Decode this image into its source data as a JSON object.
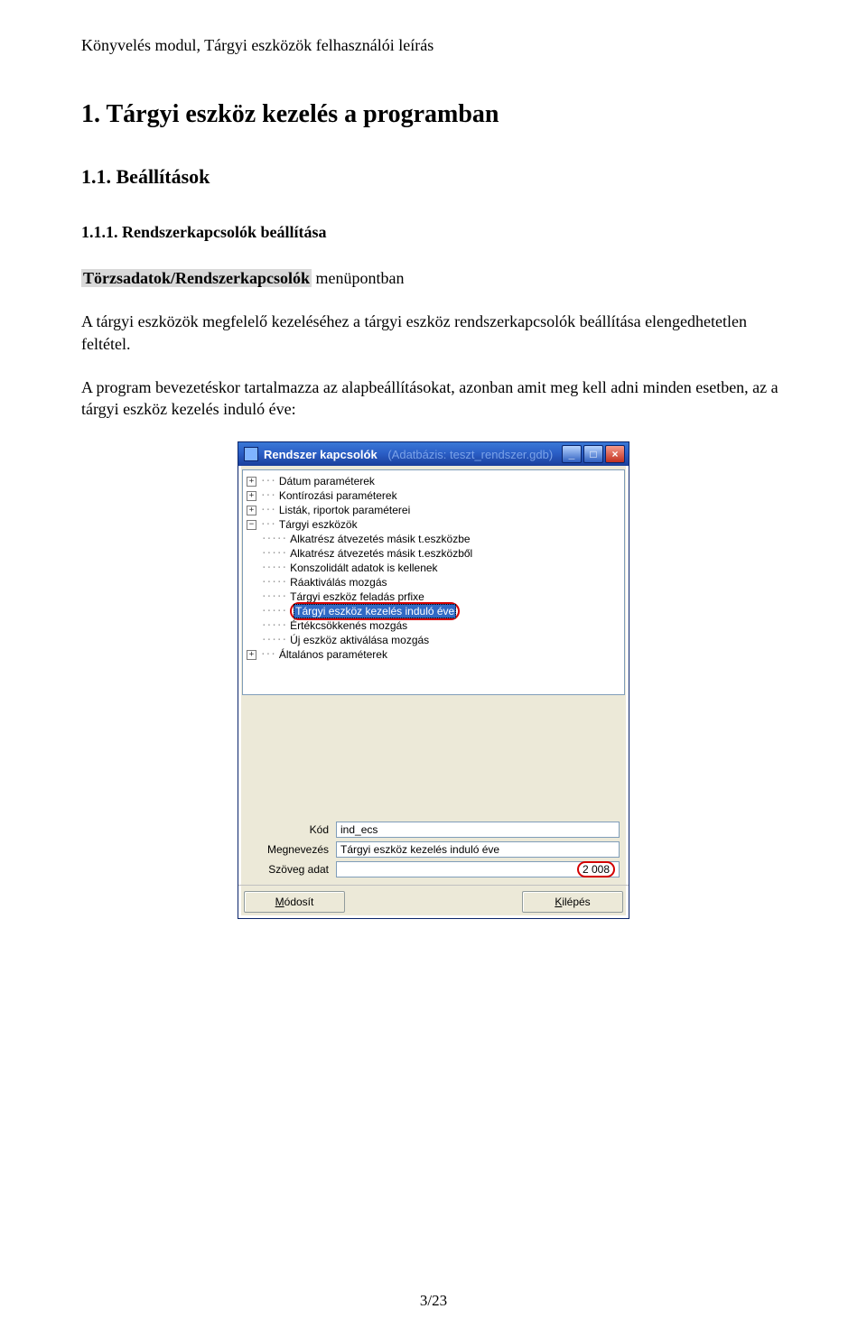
{
  "doc": {
    "header": "Könyvelés modul, Tárgyi eszközök felhasználói leírás",
    "h1": "1. Tárgyi eszköz kezelés a programban",
    "h2": "1.1. Beállítások",
    "h3": "1.1.1. Rendszerkapcsolók beállítása",
    "para1_pre": "",
    "menu_path": "Törzsadatok/Rendszerkapcsolók",
    "para1_post": " menüpontban",
    "para2": "A tárgyi eszközök megfelelő kezeléséhez a tárgyi eszköz rendszerkapcsolók beállítása elengedhetetlen feltétel.",
    "para3": "A program bevezetéskor tartalmazza az alapbeállításokat, azonban amit meg kell adni minden esetben, az a tárgyi eszköz kezelés induló éve:",
    "page_number": "3/23"
  },
  "window": {
    "title": "Rendszer kapcsolók",
    "title_faded": "(Adatbázis: teszt_rendszer.gdb)",
    "tree": {
      "top": [
        {
          "exp": "+",
          "label": "Dátum paraméterek"
        },
        {
          "exp": "+",
          "label": "Kontírozási paraméterek"
        },
        {
          "exp": "+",
          "label": "Listák, riportok paraméterei"
        },
        {
          "exp": "−",
          "label": "Tárgyi eszközök"
        }
      ],
      "children": [
        "Alkatrész átvezetés másik t.eszközbe",
        "Alkatrész átvezetés másik t.eszközből",
        "Konszolidált adatok is kellenek",
        "Ráaktiválás mozgás",
        "Tárgyi eszköz feladás prfixe"
      ],
      "selected": "Tárgyi eszköz kezelés induló éve",
      "children2": [
        "Értékcsökkenés mozgás",
        "Új eszköz aktiválása mozgás"
      ],
      "bottom": [
        {
          "exp": "+",
          "label": "Általános paraméterek"
        }
      ]
    },
    "form": {
      "kod_label": "Kód",
      "kod_value": "ind_ecs",
      "megnev_label": "Megnevezés",
      "megnev_value": "Tárgyi eszköz kezelés induló éve",
      "szoveg_label": "Szöveg adat",
      "szoveg_value": "2 008"
    },
    "buttons": {
      "modosit": "Módosít",
      "modosit_ul": "M",
      "kilepes": "Kilépés",
      "kilepes_ul": "K"
    }
  }
}
